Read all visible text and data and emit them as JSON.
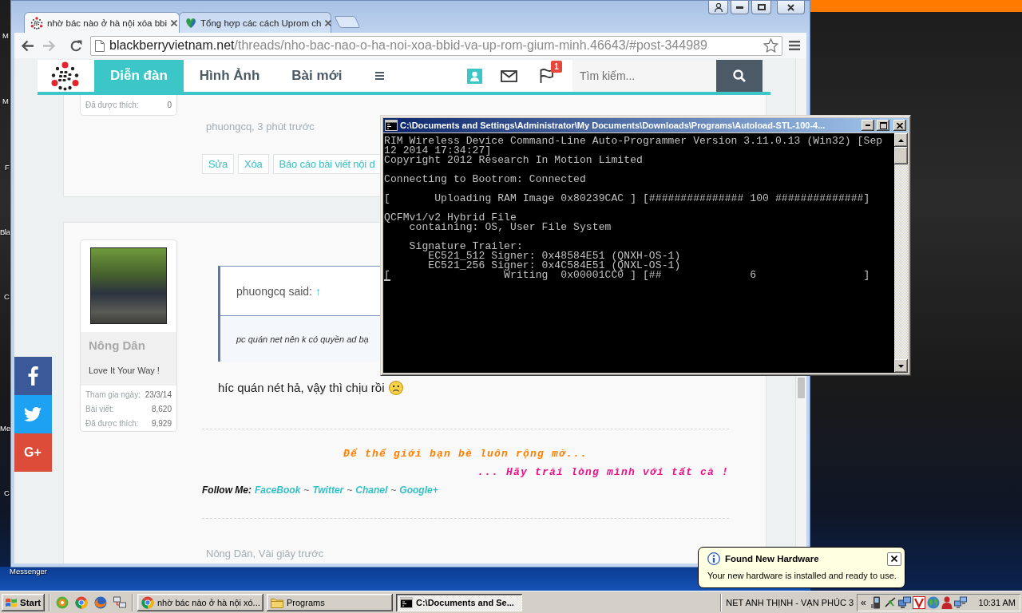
{
  "desktop": {
    "icon_labels": [
      {
        "label": "M"
      },
      {
        "label": "M"
      },
      {
        "label": "F"
      },
      {
        "label": "Bla"
      },
      {
        "label": "C"
      },
      {
        "label": "Me"
      },
      {
        "label": "C"
      },
      {
        "label": "Messenger"
      }
    ]
  },
  "browser": {
    "tabs": [
      {
        "title": "nhờ bác nào ở hà nội xóa bbi",
        "selected": true
      },
      {
        "title": "Tổng hợp các cách Uprom ch",
        "selected": false
      }
    ],
    "nav_buttons": [
      {
        "kind": "back",
        "disabled": false
      },
      {
        "kind": "forward",
        "disabled": true
      },
      {
        "kind": "reload",
        "disabled": false
      }
    ],
    "url": {
      "host": "blackberryvietnam.net",
      "path": "/threads/nho-bac-nao-o-ha-noi-xoa-bbid-va-up-rom-gium-minh.46643/#post-344989"
    }
  },
  "site_nav": {
    "items": [
      {
        "label": "Diễn đàn",
        "selected": true
      },
      {
        "label": "Hình Ảnh",
        "selected": false
      },
      {
        "label": "Bài mới",
        "selected": false
      }
    ],
    "alerts_badge": "1",
    "search": {
      "placeholder": "Tìm kiếm..."
    }
  },
  "share_buttons": [
    {
      "kind": "facebook"
    },
    {
      "kind": "twitter"
    },
    {
      "kind": "googleplus",
      "label": "G+"
    }
  ],
  "posts": [
    {
      "author_stats": [
        {
          "label": "Đã được thích:",
          "value": "0"
        }
      ],
      "byline": "phuongcq, 3 phút trước",
      "actions": [
        "Sửa",
        "Xóa",
        "Báo cáo bài viết nội d"
      ]
    },
    {
      "author": {
        "name": "Nông Dân",
        "user_title": "Love It Your Way !",
        "stats": [
          {
            "label": "Tham gia ngày:",
            "value": "23/3/14"
          },
          {
            "label": "Bài viết:",
            "value": "8,620"
          },
          {
            "label": "Đã được thích:",
            "value": "9,929"
          }
        ]
      },
      "quote": {
        "attribution": "phuongcq said:",
        "jump_link": "↑",
        "text": "pc quán net nên k có quyền ad bạ"
      },
      "message": "híc quán nét hả, vậy thì chịu rồi",
      "signature": {
        "line_1": "Để thế giới bạn bè luôn rộng mở...",
        "line_2": "... Hãy trải lòng mình với tất cả !",
        "follow_label": "Follow Me:",
        "links": [
          {
            "label": "FaceBook",
            "separator": "~"
          },
          {
            "label": "Twitter",
            "separator": "~"
          },
          {
            "label": "Chanel",
            "separator": "~"
          },
          {
            "label": "Google+"
          }
        ]
      },
      "byline": "Nông Dân, Vài giây trước"
    }
  ],
  "console": {
    "title": "C:\\Documents and Settings\\Administrator\\My Documents\\Downloads\\Programs\\Autoload-STL-100-4...",
    "blocks": [
      [
        "RIM Wireless Device Command-Line Auto-Programmer Version 3.11.0.13 (Win32) [Sep",
        "12 2014 17:34:27]",
        "Copyright 2012 Research In Motion Limited"
      ],
      [
        "Connecting to Bootrom: Connected"
      ],
      [
        "[       Uploading RAM Image 0x80239CAC ] [############### 100 ##############]"
      ],
      [
        "QCFMv1/v2 Hybrid File",
        "    containing: OS, User File System"
      ],
      [
        "    Signature Trailer:",
        "       EC521_512 Signer: 0x48584E51 (QNXH-OS-1)",
        "       EC521_256 Signer: 0x4C584E51 (QNXL-OS-1)",
        "[                  Writing  0x00001CC0 ] [##              6                 ]"
      ]
    ]
  },
  "balloon": {
    "title": "Found New Hardware",
    "text": "Your new hardware is installed and ready to use."
  },
  "taskbar": {
    "start_label": "Start",
    "tasks": [
      {
        "label": "nhờ bác nào ở hà nội xó...",
        "kind": "browser",
        "selected": false
      },
      {
        "label": "Programs",
        "kind": "folder",
        "selected": false
      },
      {
        "label": "C:\\Documents and Se...",
        "kind": "console",
        "selected": true
      }
    ],
    "toolbar_label": "NET ANH THỊNH - VẠN PHÚC 3",
    "tray_chevron": "«",
    "clock": "10:31 AM"
  }
}
